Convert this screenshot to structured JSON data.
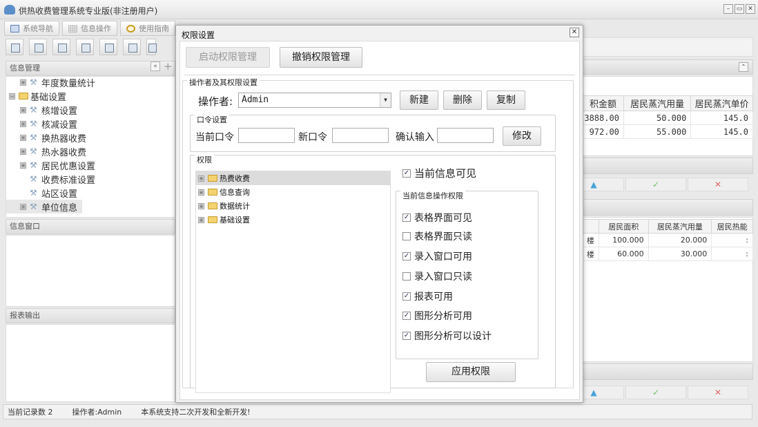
{
  "app": {
    "title": "供热收费管理系统专业版(非注册用户)"
  },
  "window_controls": {
    "minimize": "–",
    "restore": "▭",
    "close": "✕"
  },
  "tabs": [
    {
      "label": "系统导航",
      "icon": "monitor-icon"
    },
    {
      "label": "信息操作",
      "icon": "grid-icon"
    },
    {
      "label": "使用指南",
      "icon": "guide-icon"
    }
  ],
  "toolbar": {
    "icons": [
      "search-icon",
      "list-icon",
      "document-icon",
      "users-icon",
      "window-icon",
      "edit-icon",
      "print-icon"
    ]
  },
  "left_panel": {
    "title": "信息管理",
    "collapse": "«",
    "add": "+",
    "tree": [
      {
        "label": "年度数量统计",
        "level": 2,
        "type": "tool",
        "expand": "⊞"
      },
      {
        "label": "基础设置",
        "level": 1,
        "type": "folder",
        "expand": "⊟"
      },
      {
        "label": "核增设置",
        "level": 2,
        "type": "tool",
        "expand": "⊞"
      },
      {
        "label": "核减设置",
        "level": 2,
        "type": "tool",
        "expand": "⊞"
      },
      {
        "label": "换热器收费",
        "level": 2,
        "type": "tool",
        "expand": "⊞"
      },
      {
        "label": "热水器收费",
        "level": 2,
        "type": "tool",
        "expand": "⊞"
      },
      {
        "label": "居民优惠设置",
        "level": 2,
        "type": "tool",
        "expand": "⊞"
      },
      {
        "label": "收费标准设置",
        "level": 2,
        "type": "tool",
        "expand": ""
      },
      {
        "label": "站区设置",
        "level": 2,
        "type": "tool",
        "expand": ""
      },
      {
        "label": "单位信息",
        "level": 2,
        "type": "tool",
        "expand": "⊞",
        "selected": true
      }
    ],
    "info_window_title": "信息窗口",
    "report_title": "报表输出"
  },
  "right_table1": {
    "headers": [
      "积金额",
      "居民蒸汽用量",
      "居民蒸汽单价"
    ],
    "rows": [
      [
        "3888.00",
        "50.000",
        "145.0"
      ],
      [
        "972.00",
        "55.000",
        "145.0"
      ]
    ]
  },
  "right_table2": {
    "headers": [
      "",
      "居民面积",
      "居民蒸汽用量",
      "居民热能"
    ],
    "rows": [
      [
        "楼",
        "100.000",
        "20.000",
        ":"
      ],
      [
        "楼",
        "60.000",
        "30.000",
        ":"
      ]
    ]
  },
  "right_actions": {
    "up": "▲",
    "ok": "✓",
    "cancel": "✕"
  },
  "right_header_toggle": "⌃",
  "status": {
    "record_count": "当前记录数 2",
    "operator": "操作者:Admin",
    "message": "本系统支持二次开发和全新开发!"
  },
  "dialog": {
    "title": "权限设置",
    "close": "✕",
    "enable_button": "启动权限管理",
    "revoke_button": "撤销权限管理",
    "operator_section": "操作者及其权限设置",
    "operator_label": "操作者:",
    "operator_value": "Admin",
    "dropdown_arrow": "▼",
    "new_button": "新建",
    "delete_button": "删除",
    "copy_button": "复制",
    "password_section": "口令设置",
    "current_password_label": "当前口令",
    "new_password_label": "新口令",
    "confirm_label": "确认输入",
    "modify_button": "修改",
    "perm_section": "权限",
    "perm_tree": [
      {
        "label": "热费收费",
        "selected": true
      },
      {
        "label": "信息查询"
      },
      {
        "label": "数据统计"
      },
      {
        "label": "基础设置"
      }
    ],
    "tree_expand": "⊞",
    "visible_label": "当前信息可见",
    "ops_section": "当前信息操作权限",
    "ops": [
      {
        "label": "表格界面可见",
        "checked": true
      },
      {
        "label": "表格界面只读",
        "checked": false
      },
      {
        "label": "录入窗口可用",
        "checked": true
      },
      {
        "label": "录入窗口只读",
        "checked": false
      },
      {
        "label": "报表可用",
        "checked": true
      },
      {
        "label": "图形分析可用",
        "checked": true
      },
      {
        "label": "图形分析可以设计",
        "checked": true
      }
    ],
    "apply_button": "应用权限",
    "check_mark": "✓"
  }
}
